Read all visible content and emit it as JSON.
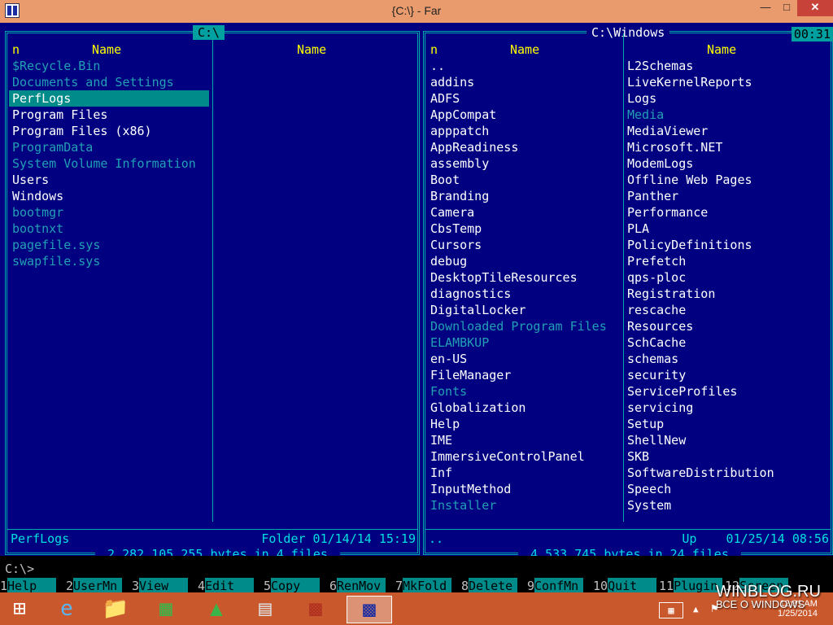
{
  "window": {
    "title": "{C:\\} - Far"
  },
  "left_panel": {
    "path": " C:\\ ",
    "col_n": "n",
    "col1_header": "Name",
    "col2_header": "Name",
    "files": [
      {
        "name": "$Recycle.Bin",
        "style": "dim"
      },
      {
        "name": "Documents and Settings",
        "style": "dim"
      },
      {
        "name": "PerfLogs",
        "style": "sel"
      },
      {
        "name": "Program Files",
        "style": "white"
      },
      {
        "name": "Program Files (x86)",
        "style": "white"
      },
      {
        "name": "ProgramData",
        "style": "dim"
      },
      {
        "name": "System Volume Information",
        "style": "dim"
      },
      {
        "name": "Users",
        "style": "white"
      },
      {
        "name": "Windows",
        "style": "white"
      },
      {
        "name": "bootmgr",
        "style": "dim"
      },
      {
        "name": "bootnxt",
        "style": "dim"
      },
      {
        "name": "pagefile.sys",
        "style": "dim"
      },
      {
        "name": "swapfile.sys",
        "style": "dim"
      }
    ],
    "status_name": "PerfLogs",
    "status_info": "Folder 01/14/14 15:19",
    "bytes": " 2,282,105,255 bytes in 4 files "
  },
  "right_panel": {
    "path": " C:\\Windows ",
    "clock": "00:31",
    "col_n": "n",
    "col1_header": "Name",
    "col2_header": "Name",
    "files_col1": [
      {
        "name": "..",
        "style": "white"
      },
      {
        "name": "addins",
        "style": "white"
      },
      {
        "name": "ADFS",
        "style": "white"
      },
      {
        "name": "AppCompat",
        "style": "white"
      },
      {
        "name": "apppatch",
        "style": "white"
      },
      {
        "name": "AppReadiness",
        "style": "white"
      },
      {
        "name": "assembly",
        "style": "white"
      },
      {
        "name": "Boot",
        "style": "white"
      },
      {
        "name": "Branding",
        "style": "white"
      },
      {
        "name": "Camera",
        "style": "white"
      },
      {
        "name": "CbsTemp",
        "style": "white"
      },
      {
        "name": "Cursors",
        "style": "white"
      },
      {
        "name": "debug",
        "style": "white"
      },
      {
        "name": "DesktopTileResources",
        "style": "white"
      },
      {
        "name": "diagnostics",
        "style": "white"
      },
      {
        "name": "DigitalLocker",
        "style": "white"
      },
      {
        "name": "Downloaded Program Files",
        "style": "dim"
      },
      {
        "name": "ELAMBKUP",
        "style": "dim"
      },
      {
        "name": "en-US",
        "style": "white"
      },
      {
        "name": "FileManager",
        "style": "white"
      },
      {
        "name": "Fonts",
        "style": "dim"
      },
      {
        "name": "Globalization",
        "style": "white"
      },
      {
        "name": "Help",
        "style": "white"
      },
      {
        "name": "IME",
        "style": "white"
      },
      {
        "name": "ImmersiveControlPanel",
        "style": "white"
      },
      {
        "name": "Inf",
        "style": "white"
      },
      {
        "name": "InputMethod",
        "style": "white"
      },
      {
        "name": "Installer",
        "style": "dim"
      }
    ],
    "files_col2": [
      {
        "name": "L2Schemas",
        "style": "white"
      },
      {
        "name": "LiveKernelReports",
        "style": "white"
      },
      {
        "name": "Logs",
        "style": "white"
      },
      {
        "name": "Media",
        "style": "dim"
      },
      {
        "name": "MediaViewer",
        "style": "white"
      },
      {
        "name": "Microsoft.NET",
        "style": "white"
      },
      {
        "name": "ModemLogs",
        "style": "white"
      },
      {
        "name": "Offline Web Pages",
        "style": "white"
      },
      {
        "name": "Panther",
        "style": "white"
      },
      {
        "name": "Performance",
        "style": "white"
      },
      {
        "name": "PLA",
        "style": "white"
      },
      {
        "name": "PolicyDefinitions",
        "style": "white"
      },
      {
        "name": "Prefetch",
        "style": "white"
      },
      {
        "name": "qps-ploc",
        "style": "white"
      },
      {
        "name": "Registration",
        "style": "white"
      },
      {
        "name": "rescache",
        "style": "white"
      },
      {
        "name": "Resources",
        "style": "white"
      },
      {
        "name": "SchCache",
        "style": "white"
      },
      {
        "name": "schemas",
        "style": "white"
      },
      {
        "name": "security",
        "style": "white"
      },
      {
        "name": "ServiceProfiles",
        "style": "white"
      },
      {
        "name": "servicing",
        "style": "white"
      },
      {
        "name": "Setup",
        "style": "white"
      },
      {
        "name": "ShellNew",
        "style": "white"
      },
      {
        "name": "SKB",
        "style": "white"
      },
      {
        "name": "SoftwareDistribution",
        "style": "white"
      },
      {
        "name": "Speech",
        "style": "white"
      },
      {
        "name": "System",
        "style": "white"
      }
    ],
    "status_name": "..",
    "status_info": "Up    01/25/14 08:56",
    "bytes": " 4,533,745 bytes in 24 files "
  },
  "command_line": "C:\\>",
  "keybar": [
    {
      "num": "1",
      "label": "Help"
    },
    {
      "num": "2",
      "label": "UserMn"
    },
    {
      "num": "3",
      "label": "View"
    },
    {
      "num": "4",
      "label": "Edit"
    },
    {
      "num": "5",
      "label": "Copy"
    },
    {
      "num": "6",
      "label": "RenMov"
    },
    {
      "num": "7",
      "label": "MkFold"
    },
    {
      "num": "8",
      "label": "Delete"
    },
    {
      "num": "9",
      "label": "ConfMn"
    },
    {
      "num": "10",
      "label": "Quit"
    },
    {
      "num": "11",
      "label": "Plugin"
    },
    {
      "num": "12",
      "label": "Screen"
    }
  ],
  "taskbar": {
    "time": "12:31 AM",
    "date": "1/25/2014",
    "keyboard_label": "▦"
  },
  "watermark": {
    "site": "WINBLOG.RU",
    "tagline": "ВСЕ О WINDOWS"
  }
}
